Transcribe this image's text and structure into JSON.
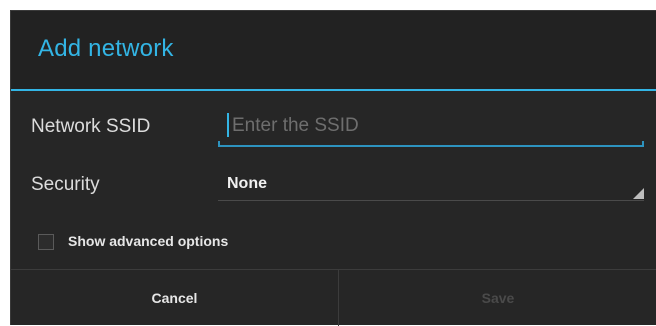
{
  "dialog": {
    "title": "Add network",
    "accent_color": "#33b5e5",
    "background": "#262626"
  },
  "form": {
    "ssid_label": "Network SSID",
    "ssid_value": "",
    "ssid_placeholder": "Enter the SSID",
    "security_label": "Security",
    "security_value": "None",
    "advanced_label": "Show advanced options",
    "advanced_checked": false
  },
  "buttons": {
    "cancel": "Cancel",
    "save": "Save",
    "save_enabled": false
  }
}
